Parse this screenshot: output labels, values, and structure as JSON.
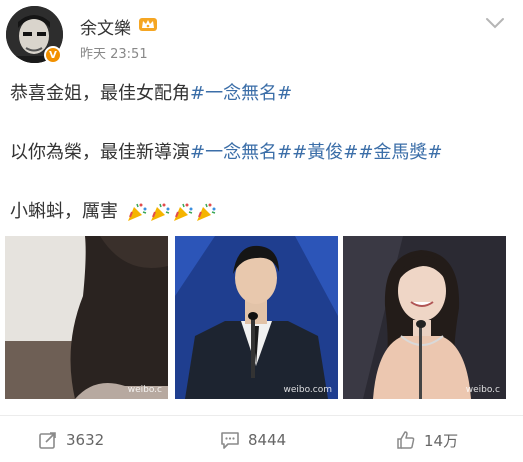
{
  "header": {
    "username": "余文樂",
    "timestamp": "昨天 23:51",
    "verified_badge": "V"
  },
  "post": {
    "line1": {
      "text": "恭喜金姐，最佳女配角",
      "tag": "#一念無名#"
    },
    "line2": {
      "text": "以你為榮，最佳新導演",
      "tags": "#一念無名##黃俊##金馬獎#"
    },
    "line3": {
      "text": "小蝌蚪，厲害",
      "emoji": "party-popper-icon",
      "emoji_count": 4
    }
  },
  "images": [
    {
      "name": "photo-woman-back",
      "watermark": "weibo.c"
    },
    {
      "name": "photo-man-podium",
      "watermark": "weibo.com"
    },
    {
      "name": "photo-woman-smiling",
      "watermark": "weibo.c"
    }
  ],
  "footer": {
    "repost_count": "3632",
    "comment_count": "8444",
    "like_count": "14万"
  },
  "colors": {
    "tag": "#3b6ea8",
    "text": "#333333",
    "meta": "#888888",
    "verify": "#f29100"
  }
}
